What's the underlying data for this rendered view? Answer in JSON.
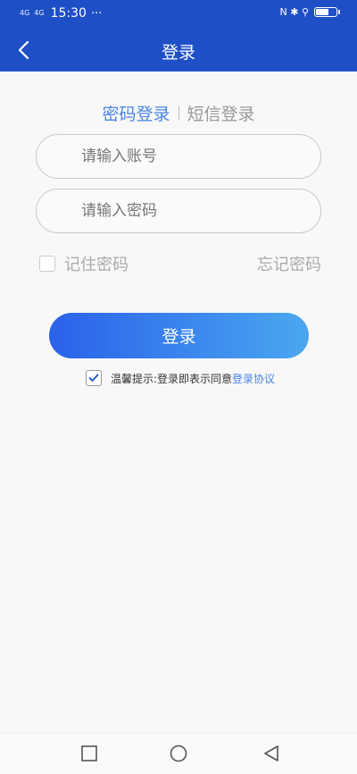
{
  "status_bar": {
    "network1": "4G",
    "network2": "4G",
    "time": "15:30",
    "extra": "···",
    "right_indicators": "N ✱ ⚲"
  },
  "nav": {
    "title": "登录",
    "back_icon": "chevron-left-icon"
  },
  "tabs": {
    "password_login": "密码登录",
    "sms_login": "短信登录"
  },
  "form": {
    "account_placeholder": "请输入账号",
    "password_placeholder": "请输入密码",
    "account_value": "",
    "password_value": ""
  },
  "options": {
    "remember_label": "记住密码",
    "forgot_label": "忘记密码"
  },
  "login_button": "登录",
  "agreement": {
    "text": "温馨提示:登录即表示同意",
    "link": "登录协议"
  },
  "colors": {
    "header": "#1f4fc7",
    "accent": "#4a84e6",
    "button_start": "#2a61ea",
    "button_end": "#4aa7f0"
  },
  "icons": {
    "square": "recent-apps-icon",
    "circle": "home-icon",
    "triangle": "back-triangle-icon"
  }
}
